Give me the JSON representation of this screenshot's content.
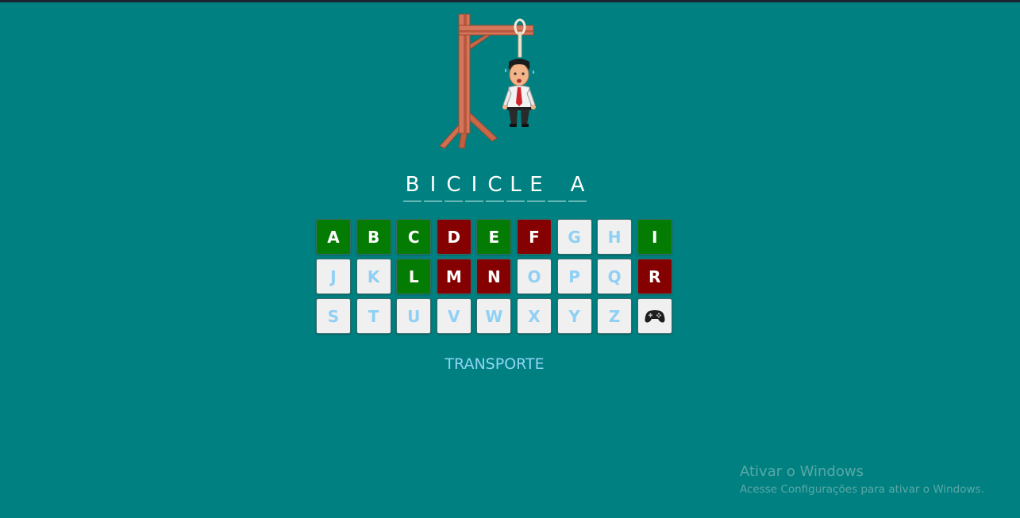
{
  "word": {
    "slots": [
      "B",
      "I",
      "C",
      "I",
      "C",
      "L",
      "E",
      "",
      "A"
    ]
  },
  "keyboard": {
    "keys": [
      {
        "letter": "A",
        "state": "correct"
      },
      {
        "letter": "B",
        "state": "correct"
      },
      {
        "letter": "C",
        "state": "correct"
      },
      {
        "letter": "D",
        "state": "wrong"
      },
      {
        "letter": "E",
        "state": "correct"
      },
      {
        "letter": "F",
        "state": "wrong"
      },
      {
        "letter": "G",
        "state": "unused"
      },
      {
        "letter": "H",
        "state": "unused"
      },
      {
        "letter": "I",
        "state": "correct"
      },
      {
        "letter": "J",
        "state": "unused"
      },
      {
        "letter": "K",
        "state": "unused"
      },
      {
        "letter": "L",
        "state": "correct"
      },
      {
        "letter": "M",
        "state": "wrong"
      },
      {
        "letter": "N",
        "state": "wrong"
      },
      {
        "letter": "O",
        "state": "unused"
      },
      {
        "letter": "P",
        "state": "unused"
      },
      {
        "letter": "Q",
        "state": "unused"
      },
      {
        "letter": "R",
        "state": "wrong"
      },
      {
        "letter": "S",
        "state": "unused"
      },
      {
        "letter": "T",
        "state": "unused"
      },
      {
        "letter": "U",
        "state": "unused"
      },
      {
        "letter": "V",
        "state": "unused"
      },
      {
        "letter": "W",
        "state": "unused"
      },
      {
        "letter": "X",
        "state": "unused"
      },
      {
        "letter": "Y",
        "state": "unused"
      },
      {
        "letter": "Z",
        "state": "unused"
      }
    ],
    "extra_key_icon": "gamepad-icon"
  },
  "category": "TRANSPORTE",
  "watermark": {
    "title": "Ativar o Windows",
    "subtitle": "Acesse Configurações para ativar o Windows."
  },
  "colors": {
    "background": "#008080",
    "correct": "#047c04",
    "wrong": "#850000",
    "unused_bg": "#f0f0f0",
    "unused_text": "#8fd0f4",
    "category_text": "#8fd5f6"
  }
}
